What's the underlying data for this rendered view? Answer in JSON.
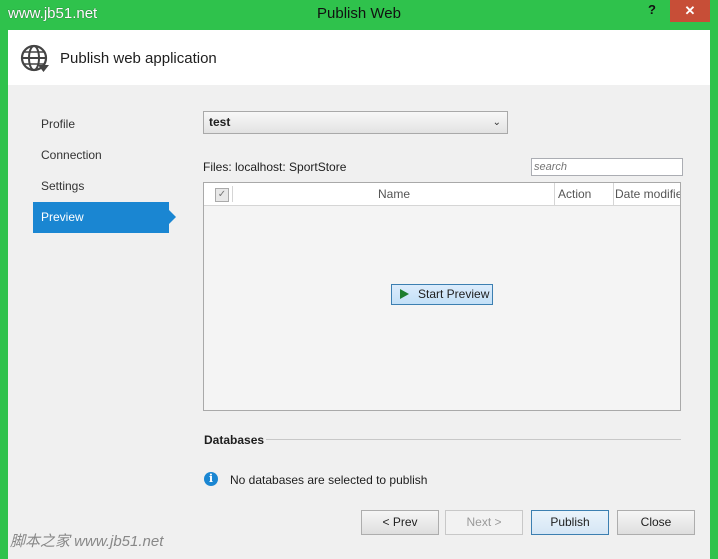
{
  "window": {
    "title": "Publish Web",
    "watermark_top": "www.jb51.net",
    "help_label": "?",
    "close_label": "✕"
  },
  "header": {
    "icon": "globe-publish-icon",
    "title": "Publish web application"
  },
  "nav": {
    "items": [
      {
        "label": "Profile"
      },
      {
        "label": "Connection"
      },
      {
        "label": "Settings"
      },
      {
        "label": "Preview",
        "active": true
      }
    ]
  },
  "profile": {
    "selected": "test"
  },
  "files": {
    "label": "Files:  localhost: SportStore",
    "search_placeholder": "search",
    "columns": [
      "Name",
      "Action",
      "Date modified"
    ],
    "start_preview_label": "Start Preview"
  },
  "databases": {
    "label": "Databases",
    "message": "No databases are selected to publish"
  },
  "buttons": {
    "prev": "< Prev",
    "next": "Next >",
    "publish": "Publish",
    "close": "Close"
  },
  "footer_watermark": "脚本之家 www.jb51.net",
  "colors": {
    "window_frame": "#2fc24c",
    "accent": "#1a86d2",
    "close_button": "#c74e37"
  }
}
